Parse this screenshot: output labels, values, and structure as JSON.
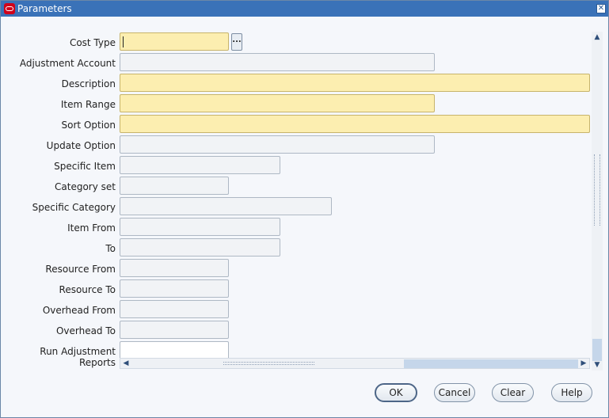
{
  "window": {
    "title": "Parameters",
    "close_label": "✕",
    "logo_icon": "oracle-logo-icon"
  },
  "fields": [
    {
      "label": "Cost Type",
      "value": "",
      "required": true,
      "has_lov": true
    },
    {
      "label": "Adjustment Account",
      "value": "",
      "required": false
    },
    {
      "label": "Description",
      "value": "",
      "required": true
    },
    {
      "label": "Item Range",
      "value": "",
      "required": true
    },
    {
      "label": "Sort Option",
      "value": "",
      "required": true
    },
    {
      "label": "Update Option",
      "value": "",
      "required": false
    },
    {
      "label": "Specific Item",
      "value": "",
      "required": false
    },
    {
      "label": "Category set",
      "value": "",
      "required": false
    },
    {
      "label": "Specific Category",
      "value": "",
      "required": false
    },
    {
      "label": "Item From",
      "value": "",
      "required": false
    },
    {
      "label": "To",
      "value": "",
      "required": false
    },
    {
      "label": "Resource From",
      "value": "",
      "required": false
    },
    {
      "label": "Resource To",
      "value": "",
      "required": false
    },
    {
      "label": "Overhead From",
      "value": "",
      "required": false
    },
    {
      "label": "Overhead To",
      "value": "",
      "required": false
    },
    {
      "label": "Run Adjustment Reports",
      "value": "",
      "required": false
    }
  ],
  "lov_button_label": "...",
  "buttons": {
    "ok": "OK",
    "cancel": "Cancel",
    "clear": "Clear",
    "help": "Help"
  },
  "colors": {
    "title_bar": "#3a72b8",
    "required_field": "#fceeb0"
  }
}
